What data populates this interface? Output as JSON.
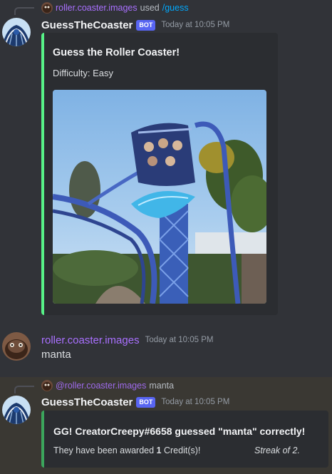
{
  "messages": [
    {
      "reply": {
        "user": "roller.coaster.images",
        "action": "used",
        "command": "/guess"
      },
      "author": "GuessTheCoaster",
      "badge": "BOT",
      "time": "Today at 10:05 PM",
      "embed": {
        "title": "Guess the Roller Coaster!",
        "description": "Difficulty: Easy",
        "accent": "#57f287"
      }
    },
    {
      "author": "roller.coaster.images",
      "time": "Today at 10:05 PM",
      "text": "manta"
    },
    {
      "reply": {
        "mention": "@roller.coaster.images",
        "text": "manta"
      },
      "author": "GuessTheCoaster",
      "badge": "BOT",
      "time": "Today at 10:05 PM",
      "embed": {
        "title": "GG! CreatorCreepy#6658 guessed \"manta\" correctly!",
        "desc_prefix": "They have been awarded ",
        "credits": "1",
        "desc_suffix": " Credit(s)!",
        "streak": "Streak of 2.",
        "accent": "#3ba55c"
      }
    }
  ],
  "colors": {
    "background": "#313338",
    "embed_bg": "#2b2d31",
    "bot_badge": "#5865f2",
    "purple_name": "#a970ff",
    "command": "#00a8fc",
    "highlight": "#3a3833"
  }
}
